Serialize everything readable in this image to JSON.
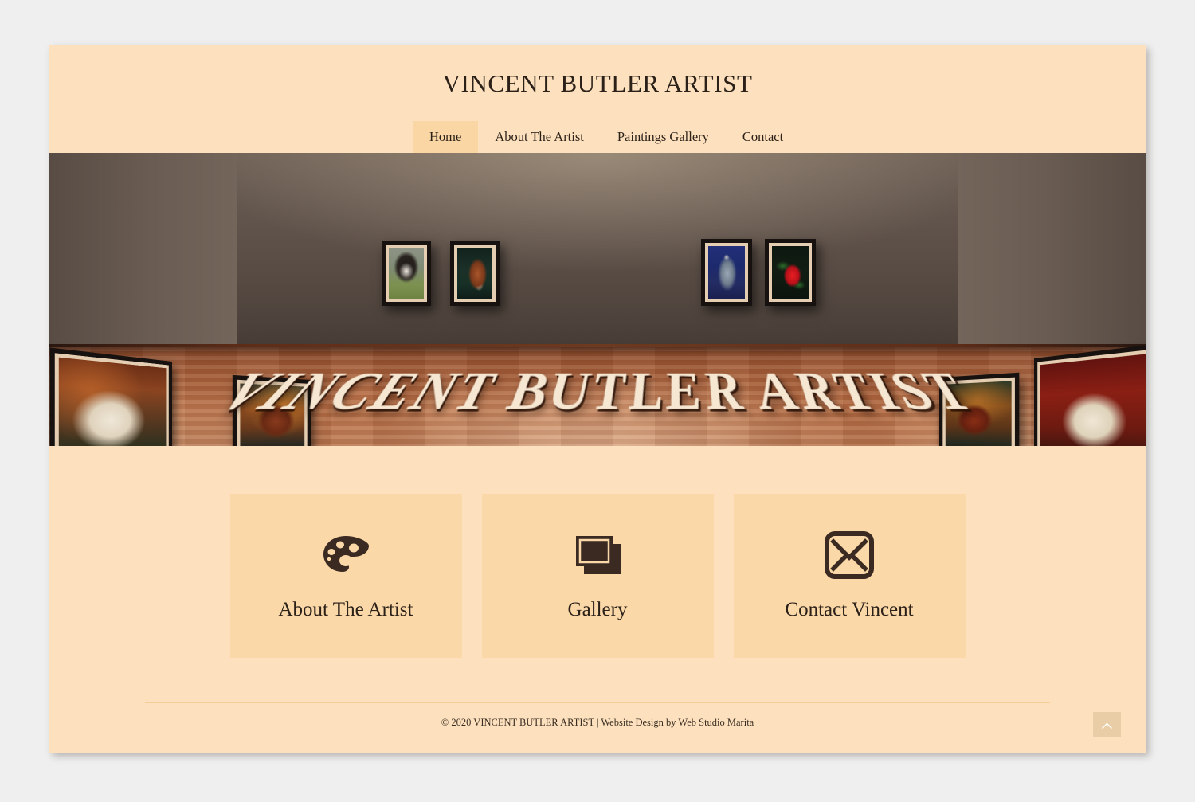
{
  "site": {
    "title": "VINCENT BUTLER ARTIST",
    "background_color": "#fde0bd",
    "accent_color": "#f9d6a4",
    "text_color": "#2b2119",
    "page_backdrop_color": "#efefef"
  },
  "nav": {
    "items": [
      {
        "label": "Home",
        "active": true
      },
      {
        "label": "About The Artist",
        "active": false
      },
      {
        "label": "Paintings Gallery",
        "active": false
      },
      {
        "label": "Contact",
        "active": false
      }
    ]
  },
  "hero": {
    "overlay_text": "VINCENT BUTLER ARTIST",
    "scene": "art-gallery-room-interior",
    "paintings": [
      {
        "id": "art-l1",
        "name": "white-horse-grazing-painting",
        "wall": "left"
      },
      {
        "id": "art-l2",
        "name": "bay-horse-standing-painting",
        "wall": "left"
      },
      {
        "id": "art-c1",
        "name": "border-collie-dog-painting",
        "wall": "back"
      },
      {
        "id": "art-c2",
        "name": "horse-head-portrait-painting",
        "wall": "back"
      },
      {
        "id": "art-c3",
        "name": "knight-helmet-painting",
        "wall": "back"
      },
      {
        "id": "art-c4",
        "name": "red-rose-painting",
        "wall": "back"
      },
      {
        "id": "art-r1",
        "name": "bay-horse-walking-painting",
        "wall": "right"
      },
      {
        "id": "art-r2",
        "name": "grey-horse-with-saddle-painting",
        "wall": "right"
      }
    ]
  },
  "cards": [
    {
      "label": "About The Artist",
      "icon": "palette-icon"
    },
    {
      "label": "Gallery",
      "icon": "photos-stack-icon"
    },
    {
      "label": "Contact Vincent",
      "icon": "envelope-icon"
    }
  ],
  "footer": {
    "text": "© 2020 VINCENT BUTLER ARTIST | Website Design by Web Studio Marita"
  },
  "scroll_top": {
    "icon": "chevron-up-icon",
    "label": ""
  }
}
